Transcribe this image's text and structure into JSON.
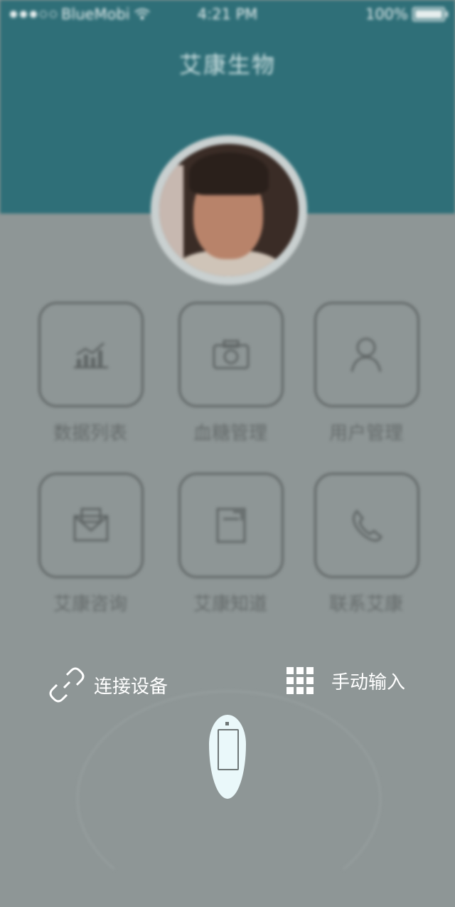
{
  "status_bar": {
    "carrier": "BlueMobi",
    "time": "4:21 PM",
    "battery": "100%"
  },
  "header": {
    "title": "艾康生物"
  },
  "menu": [
    {
      "label": "数据列表",
      "icon": "chart-icon"
    },
    {
      "label": "血糖管理",
      "icon": "camera-icon"
    },
    {
      "label": "用户管理",
      "icon": "user-icon"
    },
    {
      "label": "艾康咨询",
      "icon": "mail-icon"
    },
    {
      "label": "艾康知道",
      "icon": "note-icon"
    },
    {
      "label": "联系艾康",
      "icon": "phone-icon"
    }
  ],
  "actions": {
    "connect_label": "连接设备",
    "manual_label": "手动输入"
  }
}
